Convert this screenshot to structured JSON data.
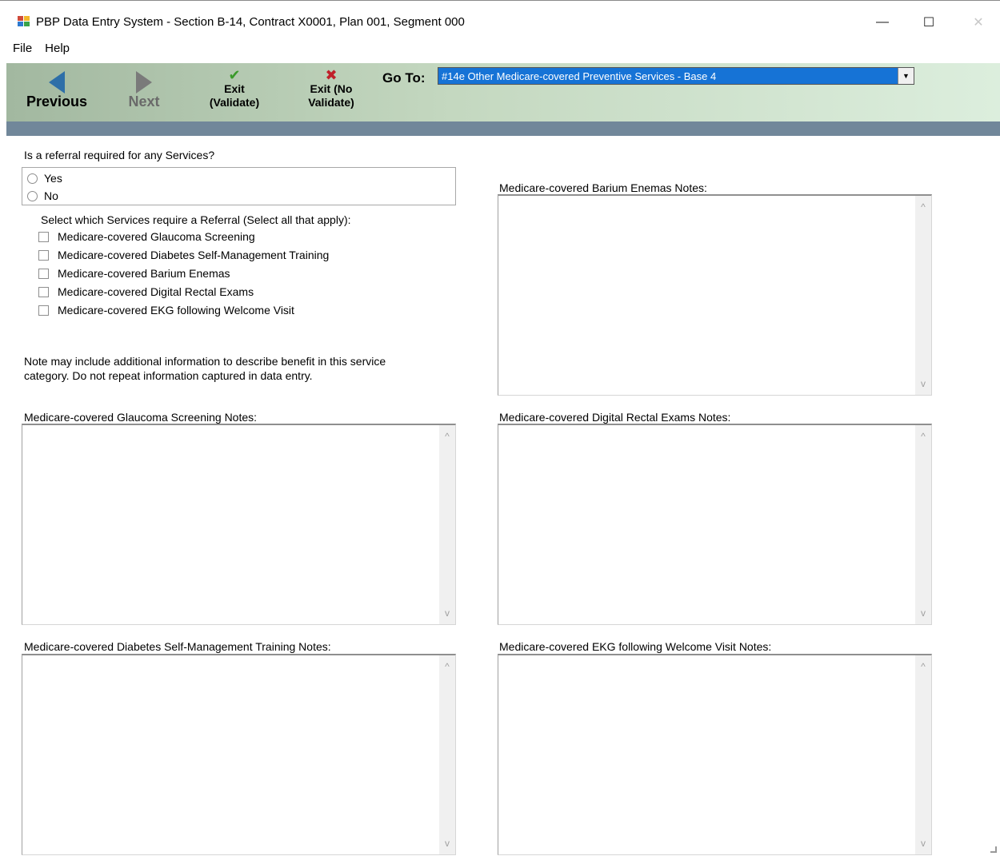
{
  "window": {
    "title": "PBP Data Entry System - Section B-14, Contract X0001, Plan 001, Segment 000",
    "minimize_glyph": "—",
    "maximize_glyph": "☐",
    "close_glyph": "✕"
  },
  "menu": {
    "items": [
      "File",
      "Help"
    ]
  },
  "toolbar": {
    "previous_label": "Previous",
    "next_label": "Next",
    "exit_validate_line1": "Exit",
    "exit_validate_line2": "(Validate)",
    "exit_novalidate_line1": "Exit (No",
    "exit_novalidate_line2": "Validate)",
    "goto_label": "Go To:",
    "goto_value": "#14e Other Medicare-covered Preventive Services - Base 4",
    "goto_arrow": "▼",
    "check_glyph": "✔",
    "x_glyph": "✖"
  },
  "referral": {
    "question": "Is a referral required for any Services?",
    "options": [
      "Yes",
      "No"
    ],
    "select_prompt": "Select which Services require a Referral (Select all that apply):",
    "services": [
      "Medicare-covered Glaucoma Screening",
      "Medicare-covered Diabetes Self-Management Training",
      "Medicare-covered Barium Enemas",
      "Medicare-covered Digital Rectal Exams",
      "Medicare-covered EKG following Welcome Visit"
    ]
  },
  "note_text_line1": "Note may include additional information to describe benefit in this service",
  "note_text_line2": "category. Do not repeat information captured in data entry.",
  "notes": {
    "barium": "Medicare-covered Barium Enemas Notes:",
    "glaucoma": "Medicare-covered Glaucoma Screening Notes:",
    "rectal": "Medicare-covered Digital Rectal Exams Notes:",
    "diabetes": "Medicare-covered Diabetes Self-Management Training Notes:",
    "ekg": "Medicare-covered EKG following Welcome Visit Notes:"
  },
  "scroll_up": "^",
  "scroll_down": "v",
  "colors": {
    "toolbar_start": "#a2b8a0",
    "toolbar_end": "#dceedd",
    "blue_bar": "#71879a",
    "select_highlight": "#1673d6",
    "previous_arrow": "#2e6fa8"
  }
}
